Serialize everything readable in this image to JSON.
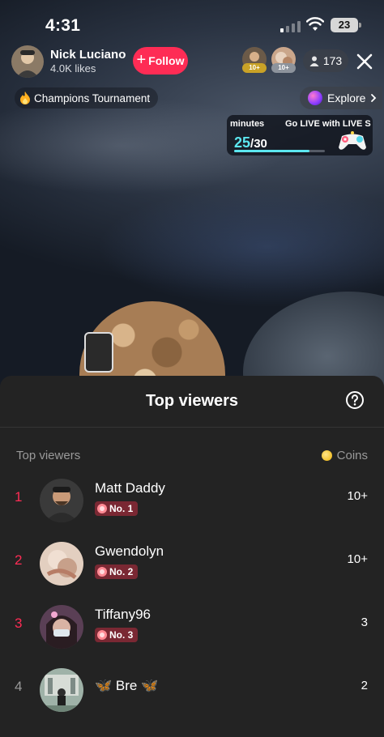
{
  "status_bar": {
    "time": "4:31",
    "battery": "23"
  },
  "host": {
    "name": "Nick Luciano",
    "likes": "4.0K likes",
    "follow_label": "Follow"
  },
  "top_bar": {
    "viewer_badges": [
      "10+",
      "10+"
    ],
    "viewer_count": "173"
  },
  "event_chip": {
    "icon": "flame-icon",
    "label": "Champions Tournament"
  },
  "explore_chip": {
    "label": "Explore"
  },
  "goal_card": {
    "ticker_a": "minutes",
    "ticker_b": "Go LIVE with LIVE S",
    "current": "25",
    "total": "/30",
    "progress": 0.83
  },
  "sheet": {
    "title": "Top viewers",
    "list_header": "Top viewers",
    "coins_header": "Coins"
  },
  "viewers": [
    {
      "rank": "1",
      "name": "Matt Daddy",
      "badge": "No. 1",
      "coins": "10+"
    },
    {
      "rank": "2",
      "name": "Gwendolyn",
      "badge": "No. 2",
      "coins": "10+"
    },
    {
      "rank": "3",
      "name": "Tiffany96",
      "badge": "No. 3",
      "coins": "3"
    },
    {
      "rank": "4",
      "name": "Bre",
      "name_prefix": "🦋",
      "name_suffix": "🦋",
      "coins": "2"
    }
  ],
  "colors": {
    "accent": "#fe2c55",
    "rank_top": "#fe2c55",
    "rank_other": "#9a9a9a",
    "sheet_bg": "#232323",
    "goal_accent": "#5ce7f0"
  }
}
